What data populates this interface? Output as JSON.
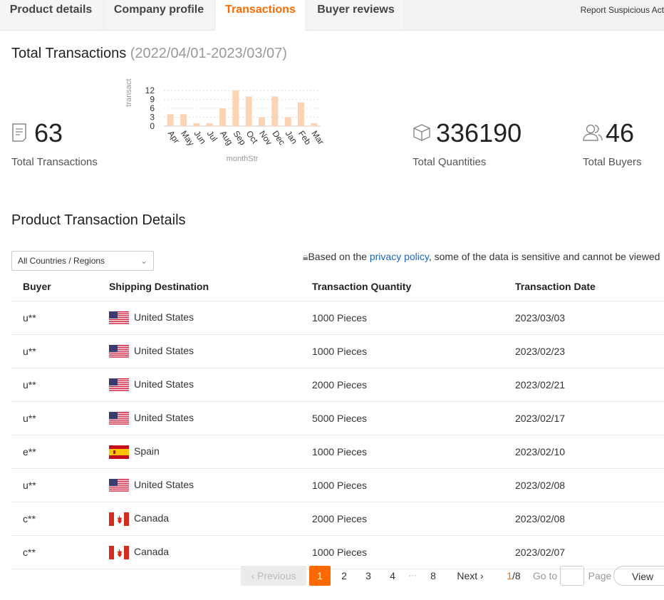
{
  "tabs": [
    "Product details",
    "Company profile",
    "Transactions",
    "Buyer reviews"
  ],
  "report": "Report Suspicious Act",
  "summary": {
    "title": "Total Transactions",
    "range": "(2022/04/01-2023/03/07)",
    "transactions": {
      "value": "63",
      "label": "Total Transactions"
    },
    "quantities": {
      "value": "336190",
      "label": "Total Quantities"
    },
    "buyers": {
      "value": "46",
      "label": "Total Buyers"
    }
  },
  "chart_data": {
    "type": "bar",
    "categories": [
      "Apr",
      "May",
      "Jun",
      "Jul",
      "Aug",
      "Sep",
      "Oct",
      "Nov",
      "Dec",
      "Jan",
      "Feb",
      "Mar"
    ],
    "values": [
      4,
      4,
      1,
      1,
      6,
      12,
      10,
      3,
      10,
      3,
      8,
      1
    ],
    "xlabel": "monthStr",
    "ylabel": "transact",
    "yticks": [
      "0",
      "3",
      "6",
      "9",
      "12"
    ],
    "ylim": [
      0,
      12
    ],
    "color": "#fdd3b5"
  },
  "details": {
    "title": "Product Transaction Details",
    "filter": "All Countries / Regions",
    "note_pre": "Based on the ",
    "note_link": "privacy policy",
    "note_post": ", some of the data is sensitive and cannot be viewed"
  },
  "table": {
    "headers": [
      "Buyer",
      "Shipping Destination",
      "Transaction Quantity",
      "Transaction Date"
    ],
    "rows": [
      [
        "u**",
        "us",
        "United States",
        "1000 Pieces",
        "2023/03/03"
      ],
      [
        "u**",
        "us",
        "United States",
        "1000 Pieces",
        "2023/02/23"
      ],
      [
        "u**",
        "us",
        "United States",
        "2000 Pieces",
        "2023/02/21"
      ],
      [
        "u**",
        "us",
        "United States",
        "5000 Pieces",
        "2023/02/17"
      ],
      [
        "e**",
        "es",
        "Spain",
        "1000 Pieces",
        "2023/02/10"
      ],
      [
        "u**",
        "us",
        "United States",
        "1000 Pieces",
        "2023/02/08"
      ],
      [
        "c**",
        "ca",
        "Canada",
        "2000 Pieces",
        "2023/02/08"
      ],
      [
        "c**",
        "ca",
        "Canada",
        "1000 Pieces",
        "2023/02/07"
      ]
    ]
  },
  "pagination": {
    "previous": "‹ Previous",
    "pages": [
      "1",
      "2",
      "3",
      "4",
      "8"
    ],
    "ellipsis": "···",
    "next": "Next ›",
    "current": "1",
    "total": "/8",
    "goto": "Go to",
    "page": "Page",
    "view": "View"
  }
}
